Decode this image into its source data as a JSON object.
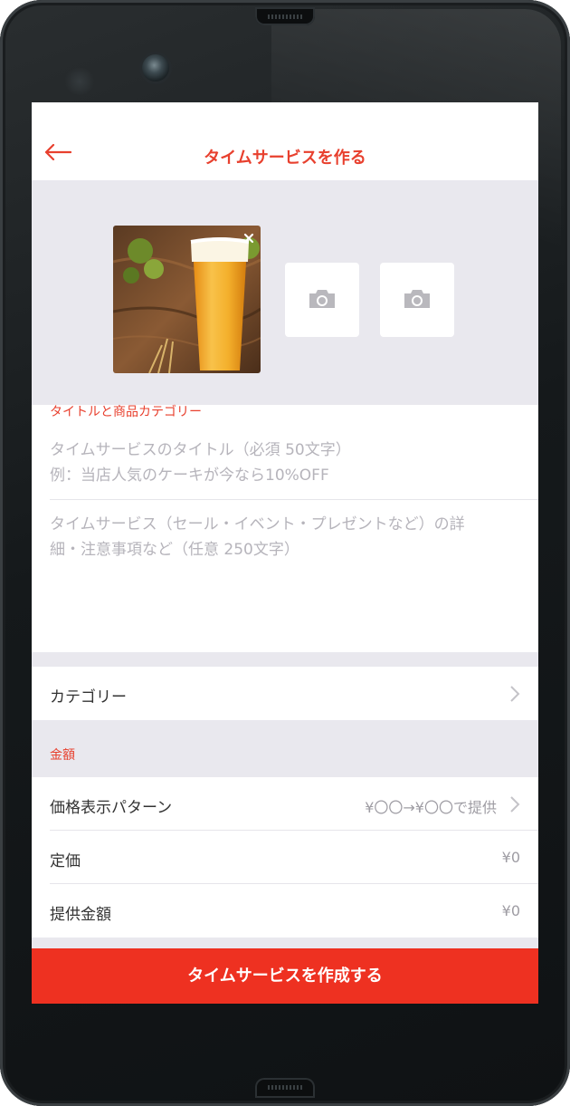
{
  "header": {
    "title": "タイムサービスを作る",
    "back_icon": "arrow-left-icon",
    "accent_color": "#e8402e"
  },
  "photos": {
    "main_image": "beer-glass-photo",
    "close_icon": "close-icon",
    "empty_slot_icon": "camera-icon",
    "empty_slots": 2
  },
  "title_section": {
    "label": "タイトルと商品カテゴリー",
    "title_placeholder_line1": "タイムサービスのタイトル（必須 50文字）",
    "title_placeholder_line2": "例：当店人気のケーキが今なら10%OFF",
    "description_placeholder_line1": "タイムサービス（セール・イベント・プレゼントなど）の詳",
    "description_placeholder_line2": "細・注意事項など（任意 250文字）"
  },
  "category_row": {
    "label": "カテゴリー",
    "chevron_icon": "chevron-right-icon"
  },
  "price_section": {
    "label": "金額",
    "pattern_label": "価格表示パターン",
    "pattern_value": "¥〇〇→¥〇〇で提供",
    "list_price_label": "定価",
    "list_price_value": "¥0",
    "offer_price_label": "提供金額",
    "offer_price_value": "¥0"
  },
  "submit": {
    "label": "タイムサービスを作成する",
    "color": "#ee3121"
  }
}
